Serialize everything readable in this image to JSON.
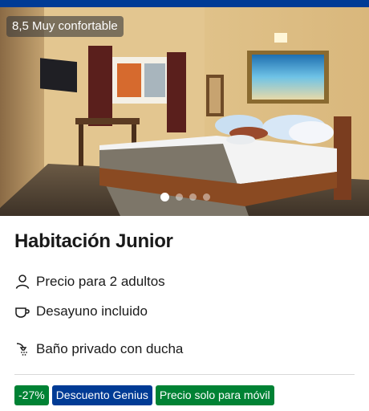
{
  "photo": {
    "score_text": "8,5 Muy confortable",
    "carousel_total": 4,
    "carousel_active": 1
  },
  "room": {
    "title": "Habitación Junior"
  },
  "features": [
    {
      "icon": "person-icon",
      "label": "Precio para 2 adultos"
    },
    {
      "icon": "coffee-cup-icon",
      "label": "Desayuno incluido"
    },
    {
      "icon": "shower-icon",
      "label": "Baño privado con ducha"
    }
  ],
  "badges": [
    {
      "label": "-27%",
      "color": "#008234"
    },
    {
      "label": "Descuento Genius",
      "color": "#003b95"
    },
    {
      "label": "Precio solo para móvil",
      "color": "#008234"
    }
  ],
  "colors": {
    "brand_blue": "#003b95",
    "deal_green": "#008234"
  }
}
